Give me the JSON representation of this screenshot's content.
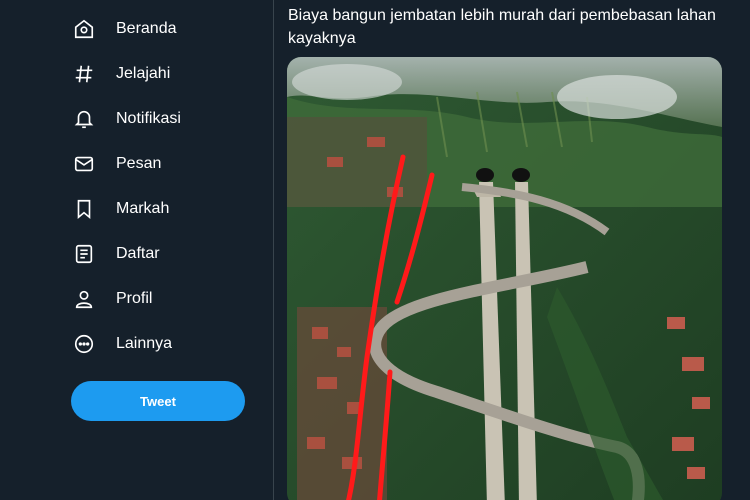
{
  "sidebar": {
    "items": [
      {
        "label": "Beranda",
        "icon": "home-icon"
      },
      {
        "label": "Jelajahi",
        "icon": "hashtag-icon"
      },
      {
        "label": "Notifikasi",
        "icon": "bell-icon"
      },
      {
        "label": "Pesan",
        "icon": "mail-icon"
      },
      {
        "label": "Markah",
        "icon": "bookmark-icon"
      },
      {
        "label": "Daftar",
        "icon": "list-icon"
      },
      {
        "label": "Profil",
        "icon": "person-icon"
      },
      {
        "label": "Lainnya",
        "icon": "more-circle-icon"
      }
    ],
    "tweet_button": "Tweet"
  },
  "post": {
    "text": "Biaya bangun jembatan lebih murah dari pembebasan lahan kayaknya",
    "image_icon": "aerial-photo-icon"
  },
  "colors": {
    "background": "#15202b",
    "accent": "#1d9bf0",
    "text": "#ffffff",
    "divider": "#38444d",
    "annotation": "#ff1a1a"
  }
}
